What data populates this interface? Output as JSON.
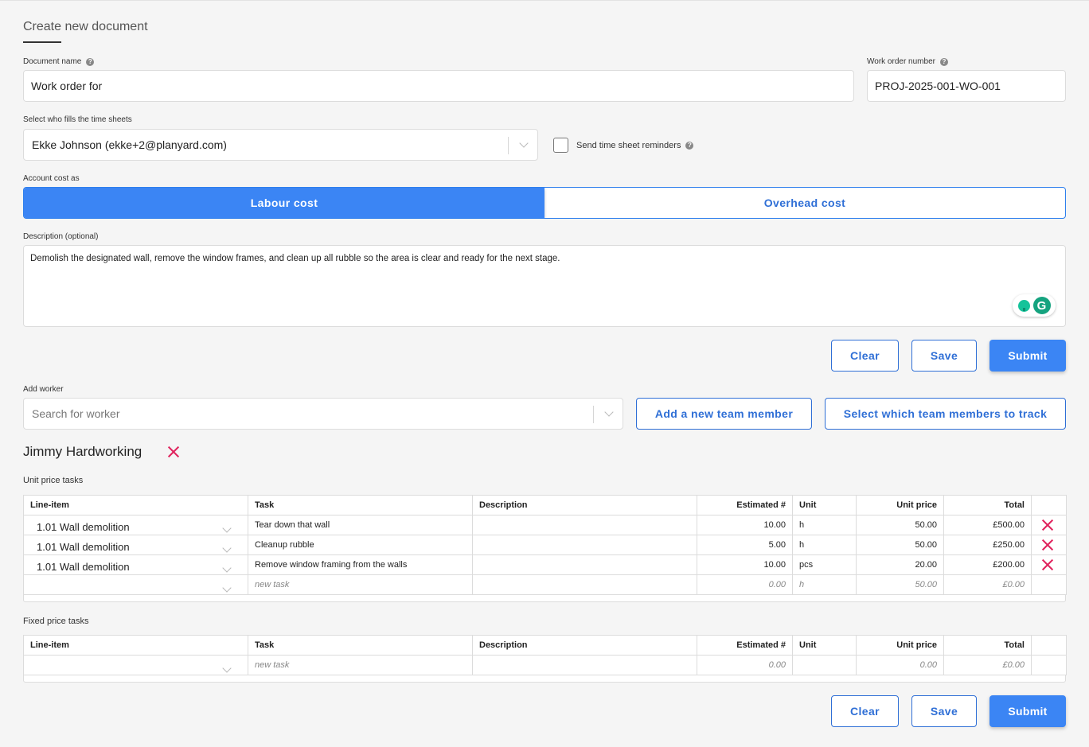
{
  "page": {
    "title": "Create new document"
  },
  "form": {
    "document_name": {
      "label": "Document name",
      "value": "Work order for"
    },
    "work_order_number": {
      "label": "Work order number",
      "value": "PROJ-2025-001-WO-001"
    },
    "time_sheets": {
      "label": "Select who fills the time sheets",
      "value": "Ekke Johnson (ekke+2@planyard.com)"
    },
    "reminders": {
      "label": "Send time sheet reminders",
      "checked": false
    },
    "account_cost": {
      "label": "Account cost as",
      "options": [
        "Labour cost",
        "Overhead cost"
      ],
      "selected": "Labour cost"
    },
    "description": {
      "label": "Description (optional)",
      "value": "Demolish the designated wall, remove the window frames, and clean up all rubble so the area is clear and ready for the next stage."
    }
  },
  "actions": {
    "clear": "Clear",
    "save": "Save",
    "submit": "Submit"
  },
  "add_worker": {
    "label": "Add worker",
    "placeholder": "Search for worker",
    "add_member": "Add a new team member",
    "select_members": "Select which team members to track"
  },
  "worker": {
    "name": "Jimmy Hardworking",
    "columns": [
      "Line-item",
      "Task",
      "Description",
      "Estimated #",
      "Unit",
      "Unit price",
      "Total"
    ],
    "unit_price": {
      "label": "Unit price tasks",
      "rows": [
        {
          "line_item": "1.01 Wall demolition",
          "task": "Tear down that wall",
          "description": "",
          "estimated": "10.00",
          "unit": "h",
          "unit_price": "50.00",
          "total": "£500.00"
        },
        {
          "line_item": "1.01 Wall demolition",
          "task": "Cleanup rubble",
          "description": "",
          "estimated": "5.00",
          "unit": "h",
          "unit_price": "50.00",
          "total": "£250.00"
        },
        {
          "line_item": "1.01 Wall demolition",
          "task": "Remove window framing from the walls",
          "description": "",
          "estimated": "10.00",
          "unit": "pcs",
          "unit_price": "20.00",
          "total": "£200.00"
        }
      ],
      "new_row": {
        "task": "new task",
        "estimated": "0.00",
        "unit": "h",
        "unit_price": "50.00",
        "total": "£0.00"
      }
    },
    "fixed_price": {
      "label": "Fixed price tasks",
      "new_row": {
        "task": "new task",
        "estimated": "0.00",
        "unit": "",
        "unit_price": "0.00",
        "total": "£0.00"
      }
    }
  },
  "colors": {
    "primary": "#3b85f4",
    "primary_text": "#2f6fd6",
    "danger": "#e0245e"
  }
}
